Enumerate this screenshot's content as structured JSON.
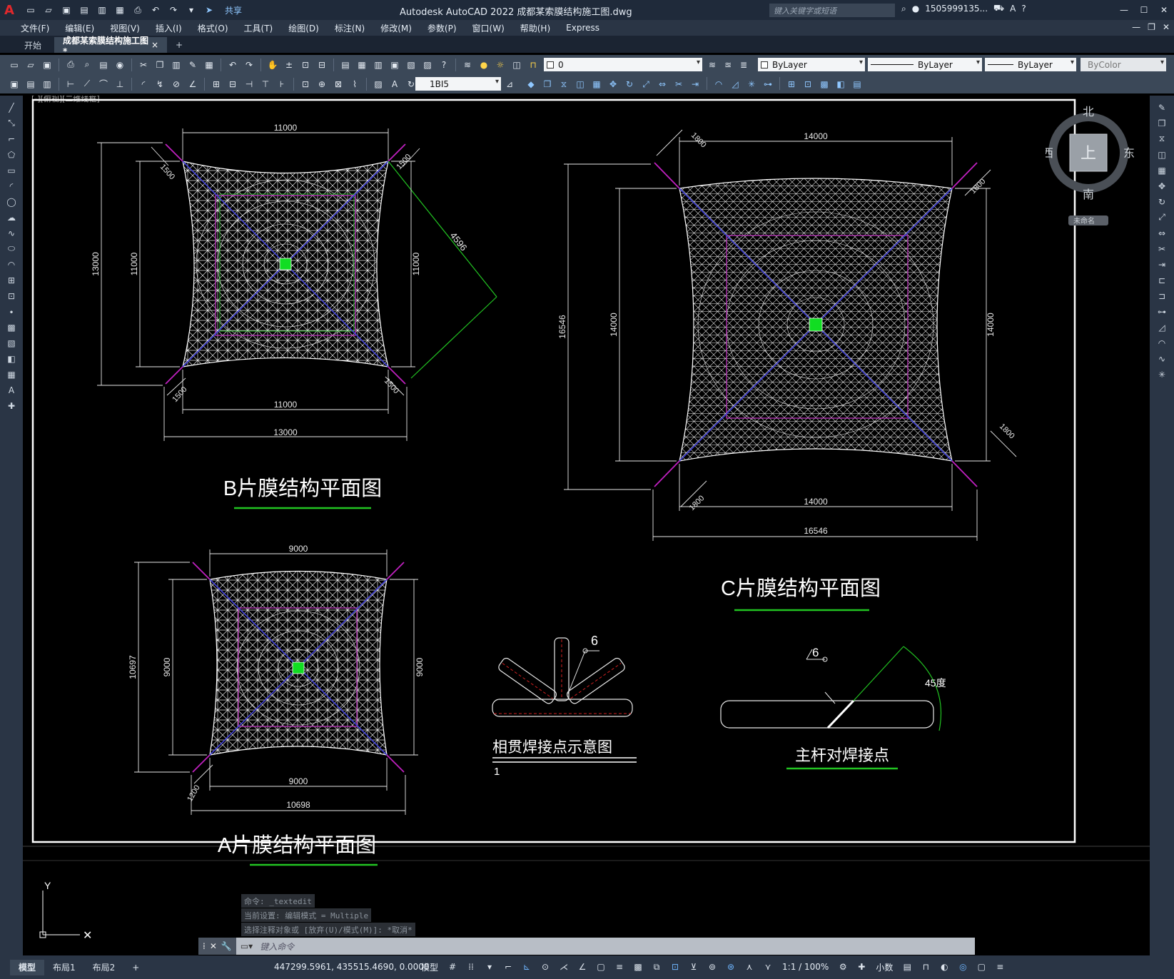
{
  "titlebar": {
    "title": "Autodesk AutoCAD 2022    成都某索膜结构施工图.dwg",
    "share": "共享",
    "search_placeholder": "键入关键字或短语",
    "user": "1505999135...",
    "logo": "A"
  },
  "menu": [
    "文件(F)",
    "编辑(E)",
    "视图(V)",
    "插入(I)",
    "格式(O)",
    "工具(T)",
    "绘图(D)",
    "标注(N)",
    "修改(M)",
    "参数(P)",
    "窗口(W)",
    "帮助(H)",
    "Express"
  ],
  "tabs": {
    "start": "开始",
    "active": "成都某索膜结构施工图*",
    "close": "×",
    "add": "+"
  },
  "toolbar": {
    "layer": "0",
    "color": "ByLayer",
    "linetype": "ByLayer",
    "lineweight": "ByLayer",
    "plotstyle": "ByColor",
    "dimstyle": "1BI5"
  },
  "viewcube": {
    "north": "北",
    "south": "南",
    "east": "东",
    "west": "西",
    "face": "上",
    "wcs": "未命名"
  },
  "drawing": {
    "b_title": "B片膜结构平面图",
    "c_title": "C片膜结构平面图",
    "a_title": "A片膜结构平面图",
    "weld1_title": "相贯焊接点示意图",
    "weld2_title": "主杆对焊接点",
    "weld_size": "6",
    "angle_label": "45度",
    "b_dims": {
      "top": "11000",
      "bottom_inner": "11000",
      "bottom_outer": "13000",
      "left_outer": "13000",
      "left_inner": "11000",
      "right_inner": "11000",
      "corner": "1500",
      "diag": "4596"
    },
    "c_dims": {
      "top": "14000",
      "bottom_inner": "14000",
      "bottom_outer": "16546",
      "left_outer": "16546",
      "left_inner": "14000",
      "right_inner": "14000",
      "corner": "1800"
    },
    "a_dims": {
      "top": "9000",
      "bottom_inner": "9000",
      "bottom_outer": "10698",
      "left_outer": "10697",
      "left_inner": "9000",
      "right_inner": "9000",
      "corner": "1200"
    },
    "ucs_y": "Y",
    "ucs_note": "1",
    "viewport_note": "[-][俯视][二维线框]"
  },
  "command": {
    "history": [
      "命令: _textedit",
      "当前设置: 编辑模式 = Multiple",
      "选择注释对象或 [放弃(U)/模式(M)]: *取消*"
    ],
    "placeholder": "键入命令"
  },
  "status": {
    "layouts": [
      "模型",
      "布局1",
      "布局2"
    ],
    "add": "+",
    "coords": "447299.5961, 435515.4690, 0.0000",
    "model": "模型",
    "scale": "1:1 / 100%",
    "units": "小数"
  }
}
